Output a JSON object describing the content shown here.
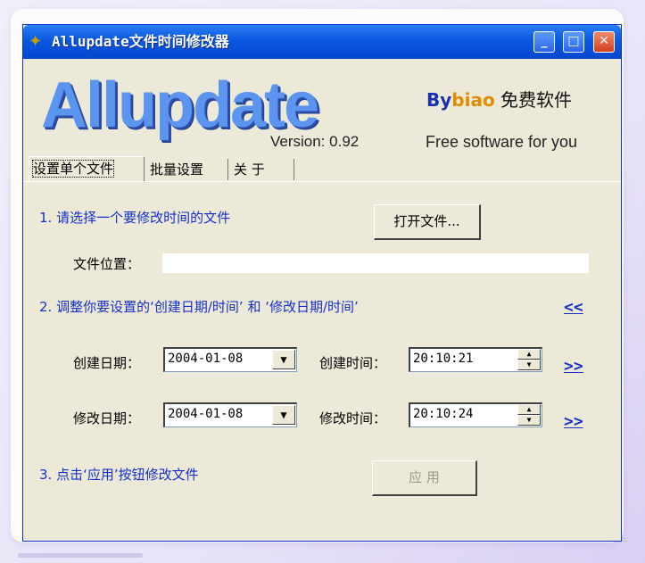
{
  "window": {
    "title": "Allupdate文件时间修改器",
    "controls": {
      "minimize": "_",
      "maximize": "□",
      "close": "✕"
    }
  },
  "header": {
    "logo": "Allupdate",
    "version": "Version: 0.92",
    "byline_by": "By",
    "byline_biao": "biao",
    "byline_free": " 免费软件",
    "tagline": "Free software for you"
  },
  "tabs": [
    {
      "label": "设置单个文件",
      "active": true
    },
    {
      "label": "批量设置",
      "active": false
    },
    {
      "label": "关 于",
      "active": false
    }
  ],
  "step1": {
    "text": "1. 请选择一个要修改时间的文件",
    "open_button": "打开文件...",
    "location_label": "文件位置：",
    "location_value": ""
  },
  "step2": {
    "text": "2. 调整你要设置的‘创建日期/时间’  和 ‘修改日期/时间’",
    "collapse_link": "<<",
    "create_date_label": "创建日期：",
    "create_date": "2004-01-08",
    "create_time_label": "创建时间：",
    "create_time": "20:10:21",
    "create_link": ">>",
    "modify_date_label": "修改日期：",
    "modify_date": "2004-01-08",
    "modify_time_label": "修改时间：",
    "modify_time": "20:10:24",
    "modify_link": ">>"
  },
  "step3": {
    "text": "3. 点击‘应用’按钮修改文件",
    "apply_button": "应 用",
    "apply_enabled": false
  },
  "colors": {
    "titlebar": "#0a58e0",
    "window_bg": "#ece9d8",
    "step_text": "#1530c8",
    "logo": "#5b95f0"
  }
}
